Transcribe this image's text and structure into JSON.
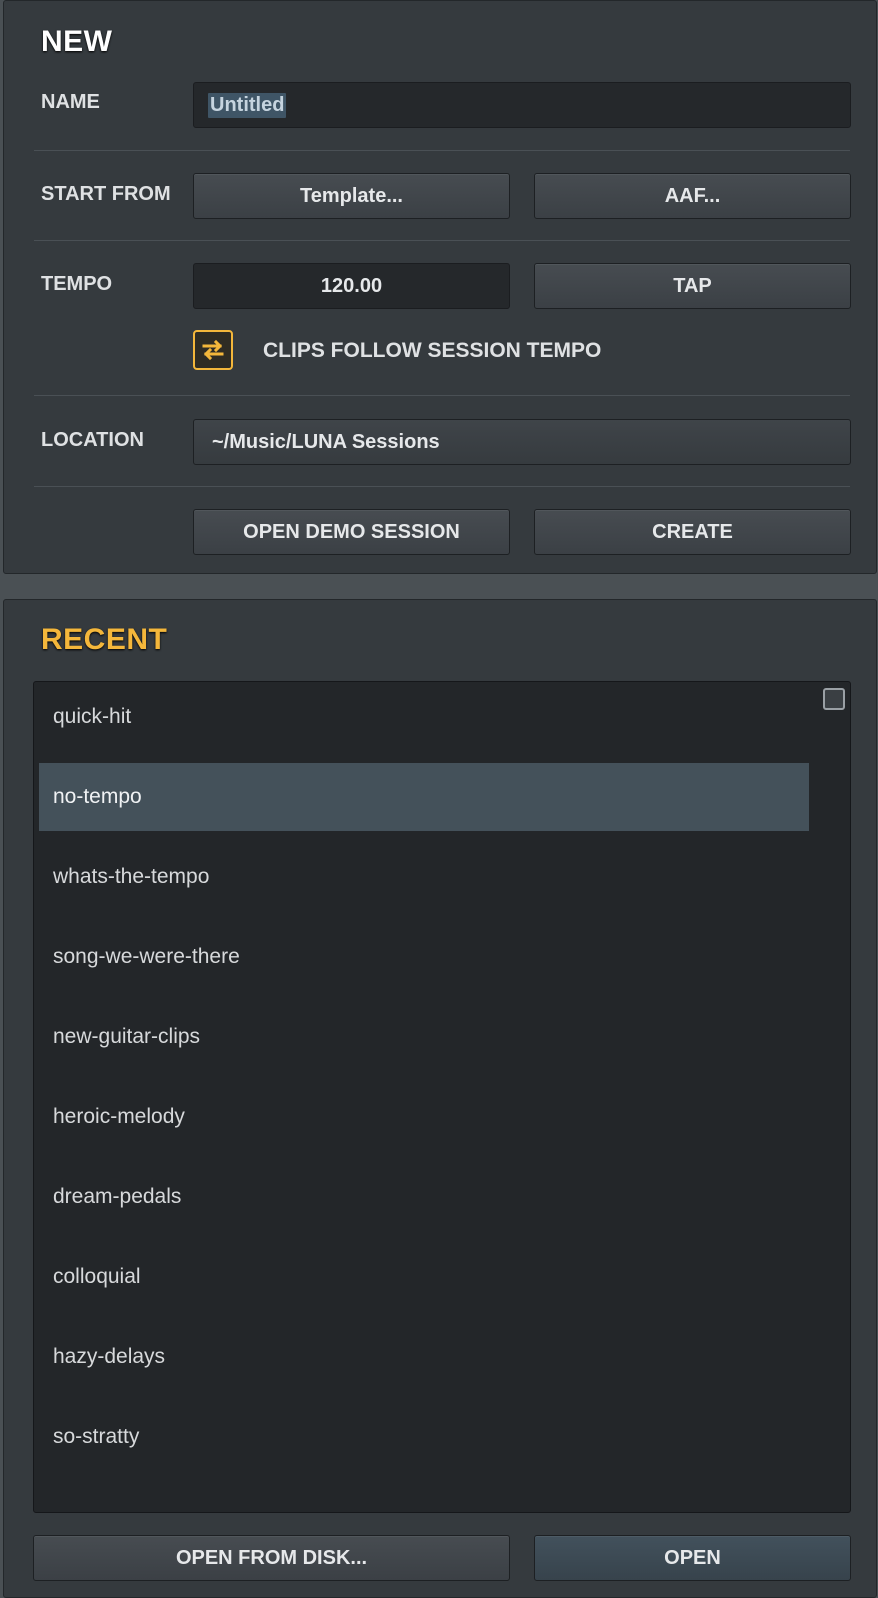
{
  "new_panel": {
    "title": "NEW",
    "name_label": "NAME",
    "name_value": "Untitled",
    "start_from_label": "START FROM",
    "template_button": "Template...",
    "aaf_button": "AAF...",
    "tempo_label": "TEMPO",
    "tempo_value": "120.00",
    "tap_button": "TAP",
    "clips_follow_label": "CLIPS FOLLOW SESSION TEMPO",
    "clips_follow_enabled": true,
    "location_label": "LOCATION",
    "location_value": "~/Music/LUNA Sessions",
    "open_demo_button": "OPEN DEMO SESSION",
    "create_button": "CREATE"
  },
  "recent_panel": {
    "title": "RECENT",
    "items": [
      {
        "label": "quick-hit",
        "selected": false
      },
      {
        "label": "no-tempo",
        "selected": true
      },
      {
        "label": "whats-the-tempo",
        "selected": false
      },
      {
        "label": "song-we-were-there",
        "selected": false
      },
      {
        "label": "new-guitar-clips",
        "selected": false
      },
      {
        "label": "heroic-melody",
        "selected": false
      },
      {
        "label": "dream-pedals",
        "selected": false
      },
      {
        "label": "colloquial",
        "selected": false
      },
      {
        "label": "hazy-delays",
        "selected": false
      },
      {
        "label": "so-stratty",
        "selected": false
      }
    ],
    "open_from_disk_button": "OPEN FROM DISK...",
    "open_button": "OPEN"
  },
  "colors": {
    "accent": "#f4b73b",
    "panel": "#353a3e",
    "background": "#4a5054",
    "selected_row": "#44515a"
  },
  "icons": {
    "clips_toggle": "sync-arrows-icon"
  }
}
